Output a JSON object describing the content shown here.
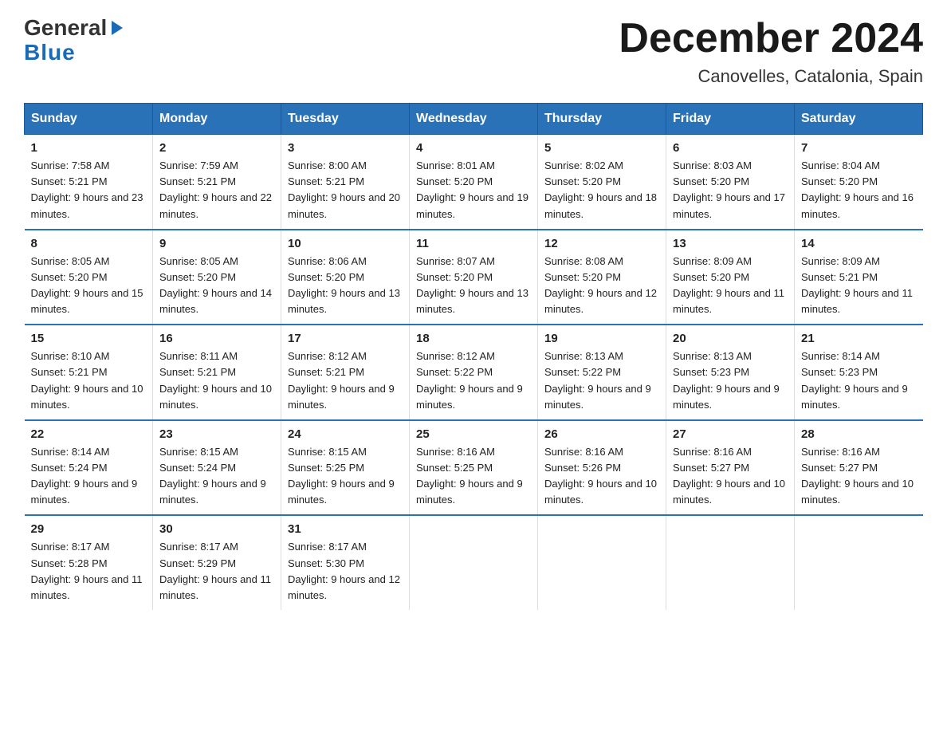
{
  "header": {
    "month_title": "December 2024",
    "subtitle": "Canovelles, Catalonia, Spain",
    "logo_general": "General",
    "logo_blue": "Blue"
  },
  "days_of_week": [
    "Sunday",
    "Monday",
    "Tuesday",
    "Wednesday",
    "Thursday",
    "Friday",
    "Saturday"
  ],
  "weeks": [
    [
      {
        "day": "1",
        "sunrise": "7:58 AM",
        "sunset": "5:21 PM",
        "daylight": "9 hours and 23 minutes."
      },
      {
        "day": "2",
        "sunrise": "7:59 AM",
        "sunset": "5:21 PM",
        "daylight": "9 hours and 22 minutes."
      },
      {
        "day": "3",
        "sunrise": "8:00 AM",
        "sunset": "5:21 PM",
        "daylight": "9 hours and 20 minutes."
      },
      {
        "day": "4",
        "sunrise": "8:01 AM",
        "sunset": "5:20 PM",
        "daylight": "9 hours and 19 minutes."
      },
      {
        "day": "5",
        "sunrise": "8:02 AM",
        "sunset": "5:20 PM",
        "daylight": "9 hours and 18 minutes."
      },
      {
        "day": "6",
        "sunrise": "8:03 AM",
        "sunset": "5:20 PM",
        "daylight": "9 hours and 17 minutes."
      },
      {
        "day": "7",
        "sunrise": "8:04 AM",
        "sunset": "5:20 PM",
        "daylight": "9 hours and 16 minutes."
      }
    ],
    [
      {
        "day": "8",
        "sunrise": "8:05 AM",
        "sunset": "5:20 PM",
        "daylight": "9 hours and 15 minutes."
      },
      {
        "day": "9",
        "sunrise": "8:05 AM",
        "sunset": "5:20 PM",
        "daylight": "9 hours and 14 minutes."
      },
      {
        "day": "10",
        "sunrise": "8:06 AM",
        "sunset": "5:20 PM",
        "daylight": "9 hours and 13 minutes."
      },
      {
        "day": "11",
        "sunrise": "8:07 AM",
        "sunset": "5:20 PM",
        "daylight": "9 hours and 13 minutes."
      },
      {
        "day": "12",
        "sunrise": "8:08 AM",
        "sunset": "5:20 PM",
        "daylight": "9 hours and 12 minutes."
      },
      {
        "day": "13",
        "sunrise": "8:09 AM",
        "sunset": "5:20 PM",
        "daylight": "9 hours and 11 minutes."
      },
      {
        "day": "14",
        "sunrise": "8:09 AM",
        "sunset": "5:21 PM",
        "daylight": "9 hours and 11 minutes."
      }
    ],
    [
      {
        "day": "15",
        "sunrise": "8:10 AM",
        "sunset": "5:21 PM",
        "daylight": "9 hours and 10 minutes."
      },
      {
        "day": "16",
        "sunrise": "8:11 AM",
        "sunset": "5:21 PM",
        "daylight": "9 hours and 10 minutes."
      },
      {
        "day": "17",
        "sunrise": "8:12 AM",
        "sunset": "5:21 PM",
        "daylight": "9 hours and 9 minutes."
      },
      {
        "day": "18",
        "sunrise": "8:12 AM",
        "sunset": "5:22 PM",
        "daylight": "9 hours and 9 minutes."
      },
      {
        "day": "19",
        "sunrise": "8:13 AM",
        "sunset": "5:22 PM",
        "daylight": "9 hours and 9 minutes."
      },
      {
        "day": "20",
        "sunrise": "8:13 AM",
        "sunset": "5:23 PM",
        "daylight": "9 hours and 9 minutes."
      },
      {
        "day": "21",
        "sunrise": "8:14 AM",
        "sunset": "5:23 PM",
        "daylight": "9 hours and 9 minutes."
      }
    ],
    [
      {
        "day": "22",
        "sunrise": "8:14 AM",
        "sunset": "5:24 PM",
        "daylight": "9 hours and 9 minutes."
      },
      {
        "day": "23",
        "sunrise": "8:15 AM",
        "sunset": "5:24 PM",
        "daylight": "9 hours and 9 minutes."
      },
      {
        "day": "24",
        "sunrise": "8:15 AM",
        "sunset": "5:25 PM",
        "daylight": "9 hours and 9 minutes."
      },
      {
        "day": "25",
        "sunrise": "8:16 AM",
        "sunset": "5:25 PM",
        "daylight": "9 hours and 9 minutes."
      },
      {
        "day": "26",
        "sunrise": "8:16 AM",
        "sunset": "5:26 PM",
        "daylight": "9 hours and 10 minutes."
      },
      {
        "day": "27",
        "sunrise": "8:16 AM",
        "sunset": "5:27 PM",
        "daylight": "9 hours and 10 minutes."
      },
      {
        "day": "28",
        "sunrise": "8:16 AM",
        "sunset": "5:27 PM",
        "daylight": "9 hours and 10 minutes."
      }
    ],
    [
      {
        "day": "29",
        "sunrise": "8:17 AM",
        "sunset": "5:28 PM",
        "daylight": "9 hours and 11 minutes."
      },
      {
        "day": "30",
        "sunrise": "8:17 AM",
        "sunset": "5:29 PM",
        "daylight": "9 hours and 11 minutes."
      },
      {
        "day": "31",
        "sunrise": "8:17 AM",
        "sunset": "5:30 PM",
        "daylight": "9 hours and 12 minutes."
      },
      null,
      null,
      null,
      null
    ]
  ],
  "labels": {
    "sunrise": "Sunrise:",
    "sunset": "Sunset:",
    "daylight": "Daylight:"
  }
}
